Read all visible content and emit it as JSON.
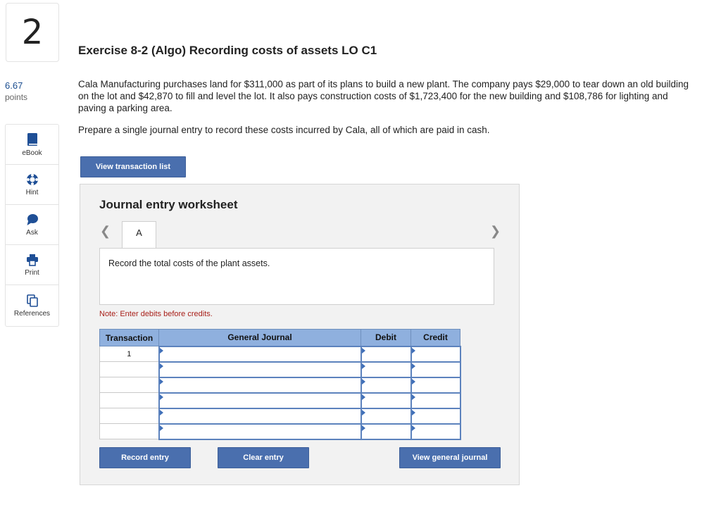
{
  "question": {
    "number": "2",
    "points_value": "6.67",
    "points_label": "points",
    "title": "Exercise 8-2 (Algo) Recording costs of assets LO C1",
    "problem_text": "Cala Manufacturing purchases land for $311,000 as part of its plans to build a new plant. The company pays $29,000 to tear down an old building on the lot and $42,870 to fill and level the lot. It also pays construction costs of $1,723,400 for the new building and $108,786 for lighting and paving a parking area.",
    "prompt_text": "Prepare a single journal entry to record these costs incurred by Cala, all of which are paid in cash."
  },
  "tools": {
    "ebook": {
      "label": "eBook",
      "icon": "book-icon"
    },
    "hint": {
      "label": "Hint",
      "icon": "lifebuoy-icon"
    },
    "ask": {
      "label": "Ask",
      "icon": "speech-bubble-icon"
    },
    "print": {
      "label": "Print",
      "icon": "printer-icon"
    },
    "references": {
      "label": "References",
      "icon": "documents-icon"
    }
  },
  "buttons": {
    "view_transaction_list": "View transaction list",
    "record_entry": "Record entry",
    "clear_entry": "Clear entry",
    "view_general_journal": "View general journal"
  },
  "worksheet": {
    "title": "Journal entry worksheet",
    "active_tab": "A",
    "instruction": "Record the total costs of the plant assets.",
    "note": "Note: Enter debits before credits.",
    "columns": {
      "transaction": "Transaction",
      "general_journal": "General Journal",
      "debit": "Debit",
      "credit": "Credit"
    },
    "rows": [
      {
        "transaction": "1",
        "general_journal": "",
        "debit": "",
        "credit": ""
      },
      {
        "transaction": "",
        "general_journal": "",
        "debit": "",
        "credit": ""
      },
      {
        "transaction": "",
        "general_journal": "",
        "debit": "",
        "credit": ""
      },
      {
        "transaction": "",
        "general_journal": "",
        "debit": "",
        "credit": ""
      },
      {
        "transaction": "",
        "general_journal": "",
        "debit": "",
        "credit": ""
      },
      {
        "transaction": "",
        "general_journal": "",
        "debit": "",
        "credit": ""
      }
    ]
  },
  "colors": {
    "button_blue": "#4a6fae",
    "header_blue": "#8fb0de",
    "note_red": "#a8201a",
    "points_blue": "#1a4d8f"
  }
}
